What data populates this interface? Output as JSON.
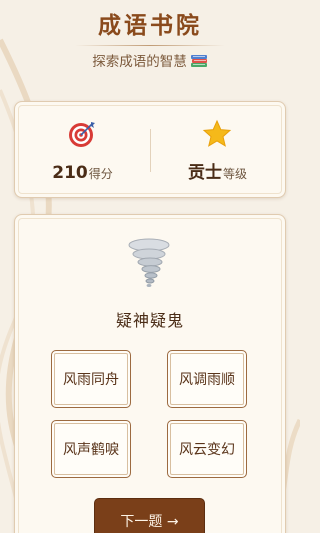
{
  "header": {
    "title": "成语书院",
    "subtitle": "探索成语的智慧"
  },
  "stats": {
    "score_value": "210",
    "score_unit": "得分",
    "rank_value": "贡士",
    "rank_unit": "等级"
  },
  "quiz": {
    "question": "疑神疑鬼",
    "options": [
      "风雨同舟",
      "风调雨顺",
      "风声鹤唳",
      "风云变幻"
    ],
    "next_label": "下一题 →"
  },
  "icons": {
    "subtitle": "books-icon",
    "score": "target-icon",
    "rank": "star-icon",
    "question": "tornado-icon"
  },
  "colors": {
    "background": "#f6f0e6",
    "title": "#8a4a1c",
    "card": "#fdf9f1",
    "button": "#7a3f19"
  }
}
